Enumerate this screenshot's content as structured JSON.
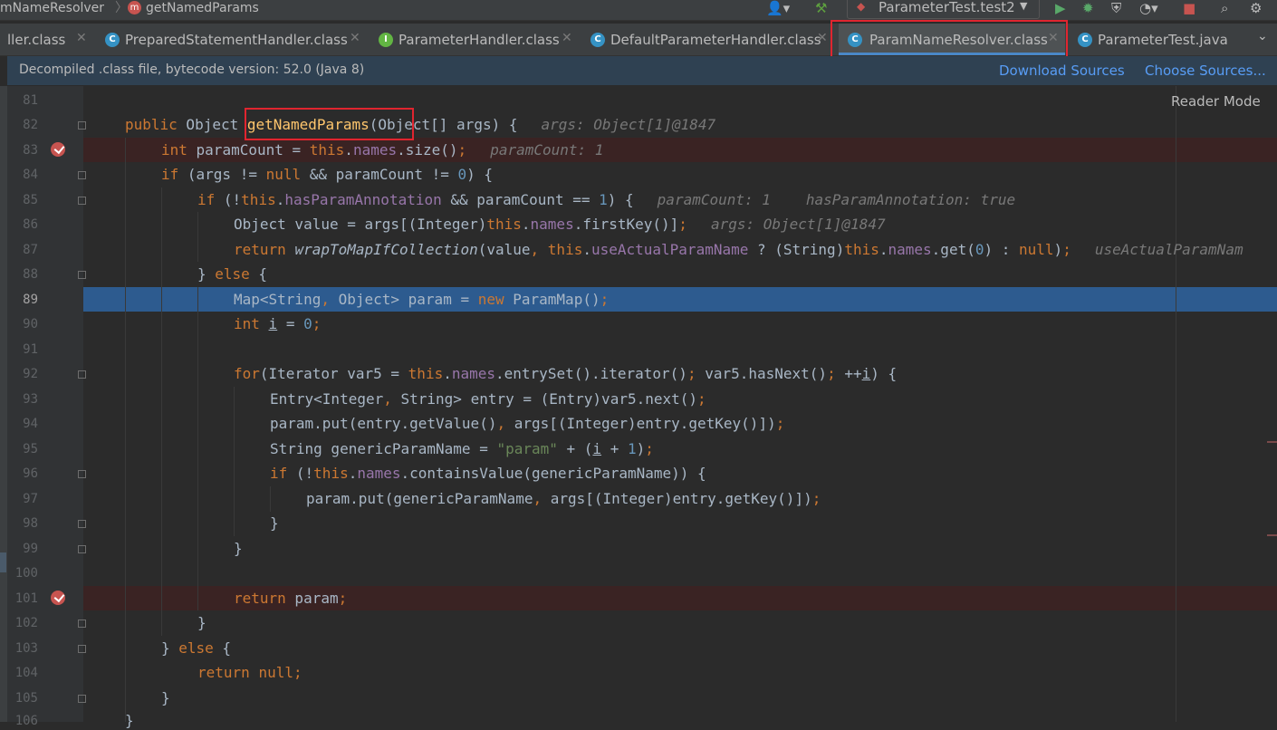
{
  "breadcrumb": {
    "class": "mNameResolver",
    "method_badge": "m",
    "method": "getNamedParams"
  },
  "toolbar": {
    "run_config": "ParameterTest.test2"
  },
  "tabs": [
    {
      "label": "ller.class",
      "icon": "C",
      "color": "#3592c4",
      "active": false
    },
    {
      "label": "PreparedStatementHandler.class",
      "icon": "C",
      "color": "#3592c4",
      "active": false
    },
    {
      "label": "ParameterHandler.class",
      "icon": "I",
      "color": "#62b543",
      "active": false
    },
    {
      "label": "DefaultParameterHandler.class",
      "icon": "C",
      "color": "#3592c4",
      "active": false
    },
    {
      "label": "ParamNameResolver.class",
      "icon": "C",
      "color": "#3592c4",
      "active": true
    },
    {
      "label": "ParameterTest.java",
      "icon": "C",
      "color": "#3592c4",
      "active": false
    }
  ],
  "banner": {
    "message": "Decompiled .class file, bytecode version: 52.0 (Java 8)",
    "download": "Download Sources",
    "choose": "Choose Sources..."
  },
  "reader_mode": "Reader Mode",
  "line_numbers": [
    "81",
    "82",
    "83",
    "84",
    "85",
    "86",
    "87",
    "88",
    "89",
    "90",
    "91",
    "92",
    "93",
    "94",
    "95",
    "96",
    "97",
    "98",
    "99",
    "100",
    "101",
    "102",
    "103",
    "104",
    "105",
    "106"
  ],
  "code": {
    "l82_public": "public",
    "l82_type": " Object ",
    "l82_method": "getNamedParams",
    "l82_sig": "(Object[] args) {",
    "l82_hint": "args: Object[1]@1847",
    "l83_int": "int",
    "l83_a": " paramCount = ",
    "l83_this": "this",
    "l83_dot": ".",
    "l83_names": "names",
    "l83_b": ".size()",
    "l83_semi": ";",
    "l83_hint": "paramCount: 1",
    "l84_if": "if",
    "l84_a": " (args != ",
    "l84_null": "null",
    "l84_b": " && paramCount != ",
    "l84_zero": "0",
    "l84_c": ") {",
    "l85_if": "if",
    "l85_a": " (!",
    "l85_this": "this",
    "l85_dot": ".",
    "l85_fld": "hasParamAnnotation",
    "l85_b": " && paramCount == ",
    "l85_one": "1",
    "l85_c": ") {",
    "l85_hint1": "paramCount: 1",
    "l85_hint2": "hasParamAnnotation: true",
    "l86_a": "Object value = args[(Integer)",
    "l86_this": "this",
    "l86_dot": ".",
    "l86_names": "names",
    "l86_b": ".firstKey()]",
    "l86_semi": ";",
    "l86_hint": "args: Object[1]@1847",
    "l87_return": "return",
    "l87_call": "wrapToMapIfCollection",
    "l87_a": "(value",
    "l87_comma": ", ",
    "l87_this": "this",
    "l87_dot": ".",
    "l87_fld": "useActualParamName",
    "l87_b": " ? (String)",
    "l87_this2": "this",
    "l87_dot2": ".",
    "l87_names": "names",
    "l87_c": ".get(",
    "l87_zero": "0",
    "l87_d": ") : ",
    "l87_null": "null",
    "l87_e": ")",
    "l87_semi": ";",
    "l87_hint": "useActualParamNam",
    "l88_a": "} ",
    "l88_else": "else",
    "l88_b": " {",
    "l89_a": "Map<String",
    "l89_comma": ", ",
    "l89_b": "Object> param = ",
    "l89_new": "new",
    "l89_c": " ParamMap()",
    "l89_semi": ";",
    "l90_int": "int",
    "l90_i": "i",
    "l90_a": " = ",
    "l90_zero": "0",
    "l90_semi": ";",
    "l92_for": "for",
    "l92_a": "(Iterator var5 = ",
    "l92_this": "this",
    "l92_dot": ".",
    "l92_names": "names",
    "l92_b": ".entrySet().iterator()",
    "l92_semi1": "; ",
    "l92_c": "var5.hasNext()",
    "l92_semi2": "; ",
    "l92_d": "++",
    "l92_i": "i",
    "l92_e": ") {",
    "l93_a": "Entry<Integer",
    "l93_comma": ", ",
    "l93_b": "String> entry = (Entry)var5.next()",
    "l93_semi": ";",
    "l94_a": "param.put(entry.getValue()",
    "l94_comma": ", ",
    "l94_b": "args[(Integer)entry.getKey()])",
    "l94_semi": ";",
    "l95_a": "String genericParamName = ",
    "l95_str": "\"param\"",
    "l95_b": " + (",
    "l95_i": "i",
    "l95_c": " + ",
    "l95_one": "1",
    "l95_d": ")",
    "l95_semi": ";",
    "l96_if": "if",
    "l96_a": " (!",
    "l96_this": "this",
    "l96_dot": ".",
    "l96_names": "names",
    "l96_b": ".containsValue(genericParamName)) {",
    "l97_a": "param.put(genericParamName",
    "l97_comma": ", ",
    "l97_b": "args[(Integer)entry.getKey()])",
    "l97_semi": ";",
    "l98": "}",
    "l99": "}",
    "l101_return": "return",
    "l101_a": " param",
    "l101_semi": ";",
    "l102": "}",
    "l103_a": "} ",
    "l103_else": "else",
    "l103_b": " {",
    "l104_return": "return",
    "l104_sp": " ",
    "l104_null": "null",
    "l104_semi": ";",
    "l105": "}",
    "l106": "}"
  }
}
